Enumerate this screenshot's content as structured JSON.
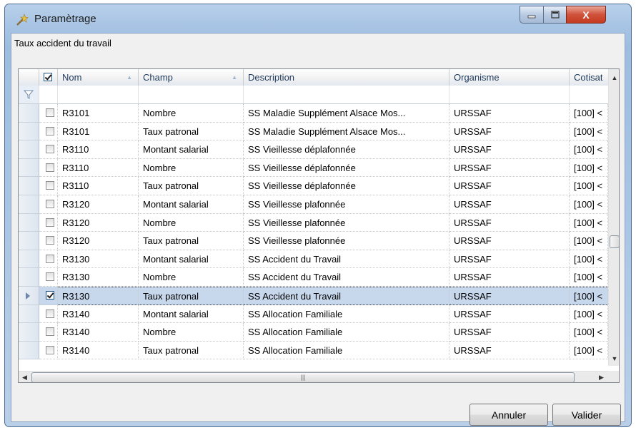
{
  "window": {
    "title": "Paramètrage",
    "close_glyph": "X"
  },
  "group_label": "Taux accident du travail",
  "grid": {
    "columns": [
      {
        "key": "select",
        "label": ""
      },
      {
        "key": "nom",
        "label": "Nom"
      },
      {
        "key": "champ",
        "label": "Champ"
      },
      {
        "key": "description",
        "label": "Description"
      },
      {
        "key": "organisme",
        "label": "Organisme"
      },
      {
        "key": "cotisation",
        "label": "Cotisat"
      }
    ],
    "header_checkbox_checked": true,
    "rows": [
      {
        "checked": false,
        "nom": "R3101",
        "champ": "Nombre",
        "description": "SS Maladie Supplément Alsace Mos...",
        "organisme": "URSSAF",
        "cotisation": "[100] <"
      },
      {
        "checked": false,
        "nom": "R3101",
        "champ": "Taux patronal",
        "description": "SS Maladie Supplément Alsace Mos...",
        "organisme": "URSSAF",
        "cotisation": "[100] <"
      },
      {
        "checked": false,
        "nom": "R3110",
        "champ": "Montant salarial",
        "description": "SS Vieillesse déplafonnée",
        "organisme": "URSSAF",
        "cotisation": "[100] <"
      },
      {
        "checked": false,
        "nom": "R3110",
        "champ": "Nombre",
        "description": "SS Vieillesse déplafonnée",
        "organisme": "URSSAF",
        "cotisation": "[100] <"
      },
      {
        "checked": false,
        "nom": "R3110",
        "champ": "Taux patronal",
        "description": "SS Vieillesse déplafonnée",
        "organisme": "URSSAF",
        "cotisation": "[100] <"
      },
      {
        "checked": false,
        "nom": "R3120",
        "champ": "Montant salarial",
        "description": "SS Vieillesse plafonnée",
        "organisme": "URSSAF",
        "cotisation": "[100] <"
      },
      {
        "checked": false,
        "nom": "R3120",
        "champ": "Nombre",
        "description": "SS Vieillesse plafonnée",
        "organisme": "URSSAF",
        "cotisation": "[100] <"
      },
      {
        "checked": false,
        "nom": "R3120",
        "champ": "Taux patronal",
        "description": "SS Vieillesse plafonnée",
        "organisme": "URSSAF",
        "cotisation": "[100] <"
      },
      {
        "checked": false,
        "nom": "R3130",
        "champ": "Montant salarial",
        "description": "SS Accident du Travail",
        "organisme": "URSSAF",
        "cotisation": "[100] <"
      },
      {
        "checked": false,
        "nom": "R3130",
        "champ": "Nombre",
        "description": "SS Accident du Travail",
        "organisme": "URSSAF",
        "cotisation": "[100] <"
      },
      {
        "checked": true,
        "selected": true,
        "nom": "R3130",
        "champ": "Taux patronal",
        "description": "SS Accident du Travail",
        "organisme": "URSSAF",
        "cotisation": "[100] <"
      },
      {
        "checked": false,
        "nom": "R3140",
        "champ": "Montant salarial",
        "description": "SS Allocation Familiale",
        "organisme": "URSSAF",
        "cotisation": "[100] <"
      },
      {
        "checked": false,
        "nom": "R3140",
        "champ": "Nombre",
        "description": "SS Allocation Familiale",
        "organisme": "URSSAF",
        "cotisation": "[100] <"
      },
      {
        "checked": false,
        "nom": "R3140",
        "champ": "Taux patronal",
        "description": "SS Allocation Familiale",
        "organisme": "URSSAF",
        "cotisation": "[100] <"
      }
    ]
  },
  "buttons": {
    "cancel": "Annuler",
    "ok": "Valider"
  },
  "icons": {
    "app": "settings-wand-icon",
    "filter": "funnel-filter-icon",
    "row_indicator": "triangle-right-icon"
  },
  "colors": {
    "selected_row": "#c7d7ec",
    "header_text": "#1e395b",
    "close_button": "#c43b20"
  }
}
